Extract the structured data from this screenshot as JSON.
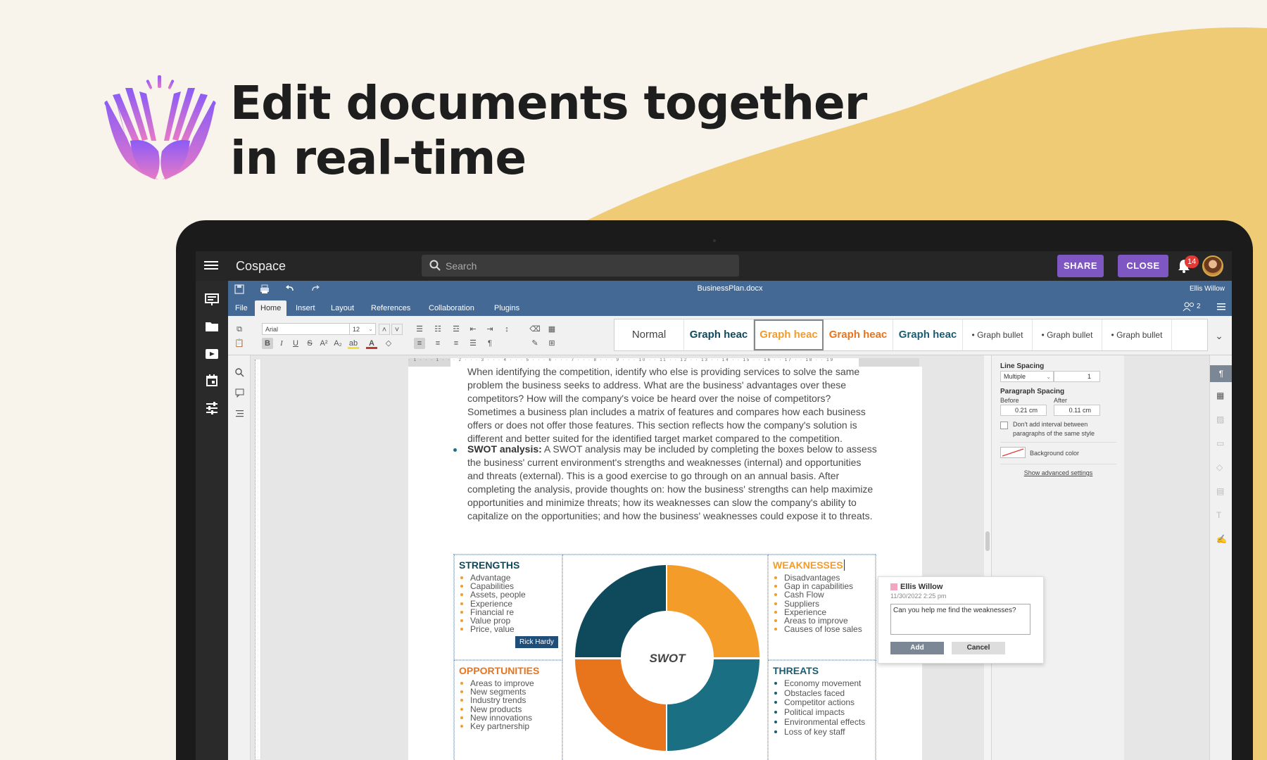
{
  "headline": {
    "line1": "Edit documents together",
    "line2": "in real-time"
  },
  "app": {
    "brand": "Cospace",
    "search_placeholder": "Search",
    "share_label": "SHARE",
    "close_label": "CLOSE",
    "notifications_count": "14",
    "accent_color": "#7e57c2"
  },
  "sidebar": {
    "icons": [
      "presentation-icon",
      "folder-icon",
      "video-icon",
      "calendar-icon",
      "sliders-icon"
    ]
  },
  "editor": {
    "filename": "BusinessPlan.docx",
    "user": "Ellis Willow",
    "users_count": "2",
    "tabs": [
      "File",
      "Home",
      "Insert",
      "Layout",
      "References",
      "Collaboration",
      "Plugins"
    ],
    "active_tab": "Home",
    "font": "Arial",
    "font_size": "12",
    "styles": [
      "Normal",
      "Graph heac",
      "Graph heac",
      "Graph heac",
      "Graph heac",
      "• Graph bullet",
      "• Graph bullet",
      "• Graph bullet"
    ],
    "ruler_marks": "· 1 · · · 1 · · · 2 · · · 3 · · · 4 · · · 5 · · · 6 · · · 7 · · · 8 · · · 9 · · · 10 · · 11 · · 12 · · 13 · · 14 · · 15 · · 16 · · 17 · · 18 · · 19"
  },
  "document": {
    "competition_text": "When identifying the competition, identify who else is providing services to solve the same problem the business seeks to address. What are the business' advantages over these competitors? How will the company's voice be heard over the noise of competitors? Sometimes a business plan includes a matrix of features and compares how each business offers or does not offer those features. This section reflects how the company's solution is different and better suited for the identified target market compared to the competition.",
    "swot_label": "SWOT analysis:",
    "swot_text": " A SWOT analysis may be included by completing the boxes below to assess the business' current environment's strengths and weaknesses (internal) and opportunities and threats (external). This is a good exercise to go through on an annual basis. After completing the analysis, provide thoughts on: how the business' strengths can help maximize opportunities and minimize threats; how its weaknesses can slow the company's ability to capitalize on the opportunities; and how the business' weaknesses could expose it to threats.",
    "swot_center": "SWOT",
    "strengths": {
      "title": "STRENGTHS",
      "items": [
        "Advantage",
        "Capabilities",
        "Assets, people",
        "Experience",
        "Financial re",
        "Value prop",
        "Price, value"
      ]
    },
    "weaknesses": {
      "title": "WEAKNESSES",
      "items": [
        "Disadvantages",
        "Gap in capabilities",
        "Cash Flow",
        "Suppliers",
        "Experience",
        "Areas to improve",
        "Causes of lose sales"
      ]
    },
    "opportunities": {
      "title": "OPPORTUNITIES",
      "items": [
        "Areas to improve",
        "New segments",
        "Industry trends",
        "New products",
        "New innovations",
        "Key partnership"
      ]
    },
    "threats": {
      "title": "THREATS",
      "items": [
        "Economy movement",
        "Obstacles faced",
        "Competitor actions",
        "Political impacts",
        "Environmental effects",
        "Loss of key staff"
      ]
    },
    "cursor_tag": "Rick Hardy"
  },
  "comment": {
    "author": "Ellis Willow",
    "date": "11/30/2022 2:25 pm",
    "text": "Can you help me find the weaknesses?",
    "add_label": "Add",
    "cancel_label": "Cancel"
  },
  "paragraph_settings": {
    "line_spacing_label": "Line Spacing",
    "line_spacing_mode": "Multiple",
    "line_spacing_value": "1",
    "paragraph_spacing_label": "Paragraph Spacing",
    "before_label": "Before",
    "after_label": "After",
    "before_value": "0.21 cm",
    "after_value": "0.11 cm",
    "no_interval_label": "Don't add interval between paragraphs of the same style",
    "background_color_label": "Background color",
    "advanced_label": "Show advanced settings"
  },
  "colors": {
    "orange": "#f39c2a",
    "teal": "#1a5d72",
    "dark_teal": "#0f4a5c",
    "orange_dark": "#e8741c",
    "toolbar_blue": "#446995"
  }
}
